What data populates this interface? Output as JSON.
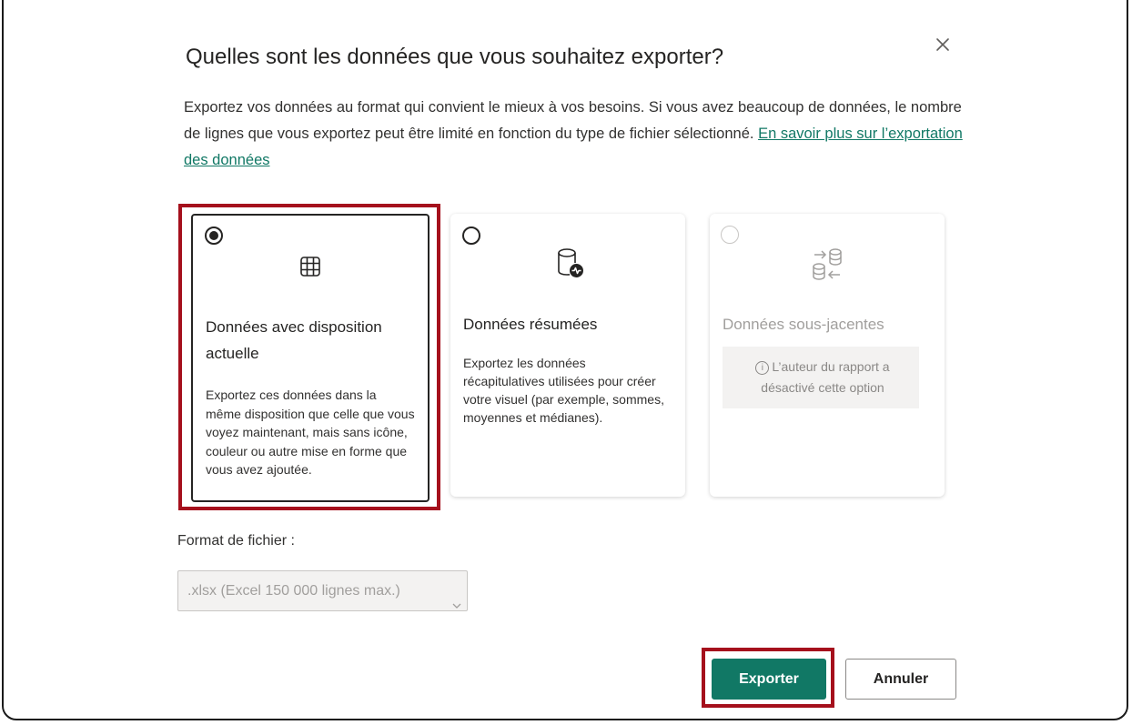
{
  "dialog": {
    "title": "Quelles sont les données que vous souhaitez exporter?",
    "description": "Exportez vos données au format qui convient le mieux à vos besoins. Si vous avez beaucoup de données, le nombre de lignes que vous exportez peut être limité en fonction du type de fichier sélectionné.",
    "learn_more_link": "En savoir plus sur l’exportation des données",
    "close_icon": "close-icon"
  },
  "options": [
    {
      "title": "Données avec disposition actuelle",
      "description": "Exportez ces données dans la même disposition que celle que vous voyez maintenant, mais sans icône, couleur ou autre mise en forme que vous avez ajoutée.",
      "icon": "table-icon",
      "selected": true,
      "disabled": false
    },
    {
      "title": "Données résumées",
      "description": "Exportez les données récapitulatives utilisées pour créer votre visuel (par exemple, sommes, moyennes et médianes).",
      "icon": "database-summary-icon",
      "selected": false,
      "disabled": false
    },
    {
      "title": "Données sous-jacentes",
      "disabled_note": "L’auteur du rapport a désactivé cette option",
      "icon": "database-transfer-icon",
      "selected": false,
      "disabled": true
    }
  ],
  "file_format": {
    "label": "Format de fichier :",
    "value": ".xlsx (Excel 150 000 lignes max.)"
  },
  "buttons": {
    "export": "Exporter",
    "cancel": "Annuler"
  },
  "colors": {
    "primary": "#117865",
    "highlight": "#a5101c",
    "text": "#252423",
    "disabled_text": "#a19f9d"
  }
}
